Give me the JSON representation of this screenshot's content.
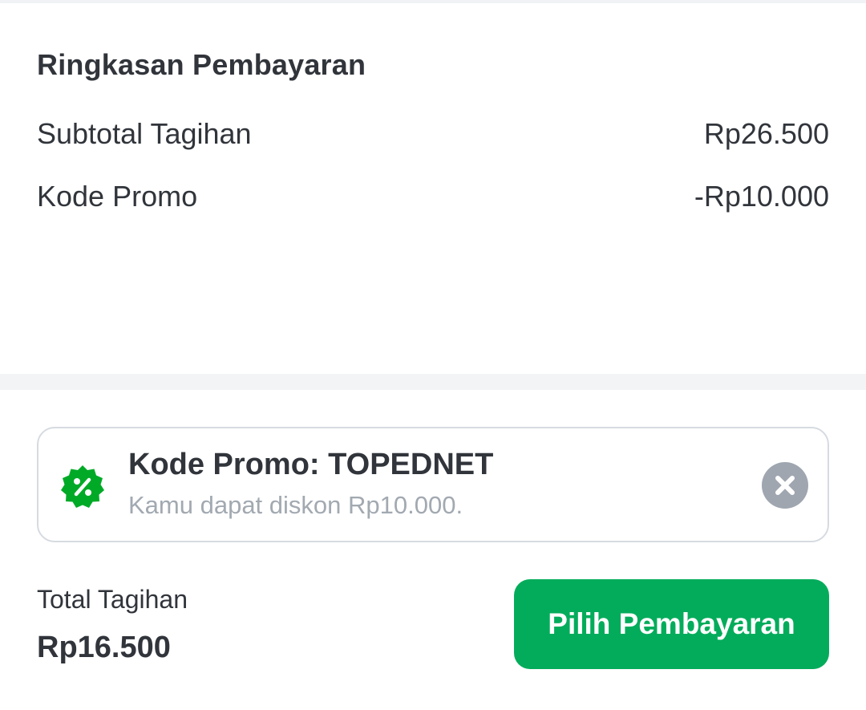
{
  "summary": {
    "title": "Ringkasan Pembayaran",
    "rows": [
      {
        "label": "Subtotal Tagihan",
        "value": "Rp26.500"
      },
      {
        "label": "Kode Promo",
        "value": "-Rp10.000"
      }
    ]
  },
  "promo_card": {
    "icon": "discount-badge-icon",
    "title": "Kode Promo: TOPEDNET",
    "subtitle": "Kamu dapat diskon Rp10.000.",
    "remove_icon": "close-circle-icon"
  },
  "footer": {
    "total_label": "Total Tagihan",
    "total_value": "Rp16.500",
    "pay_button_label": "Pilih Pembayaran"
  },
  "colors": {
    "accent_green": "#03ac5b",
    "badge_green": "#00aa27",
    "text_primary": "#31353b",
    "text_secondary": "#a2a9b1",
    "close_grey": "#9fa6b0"
  }
}
